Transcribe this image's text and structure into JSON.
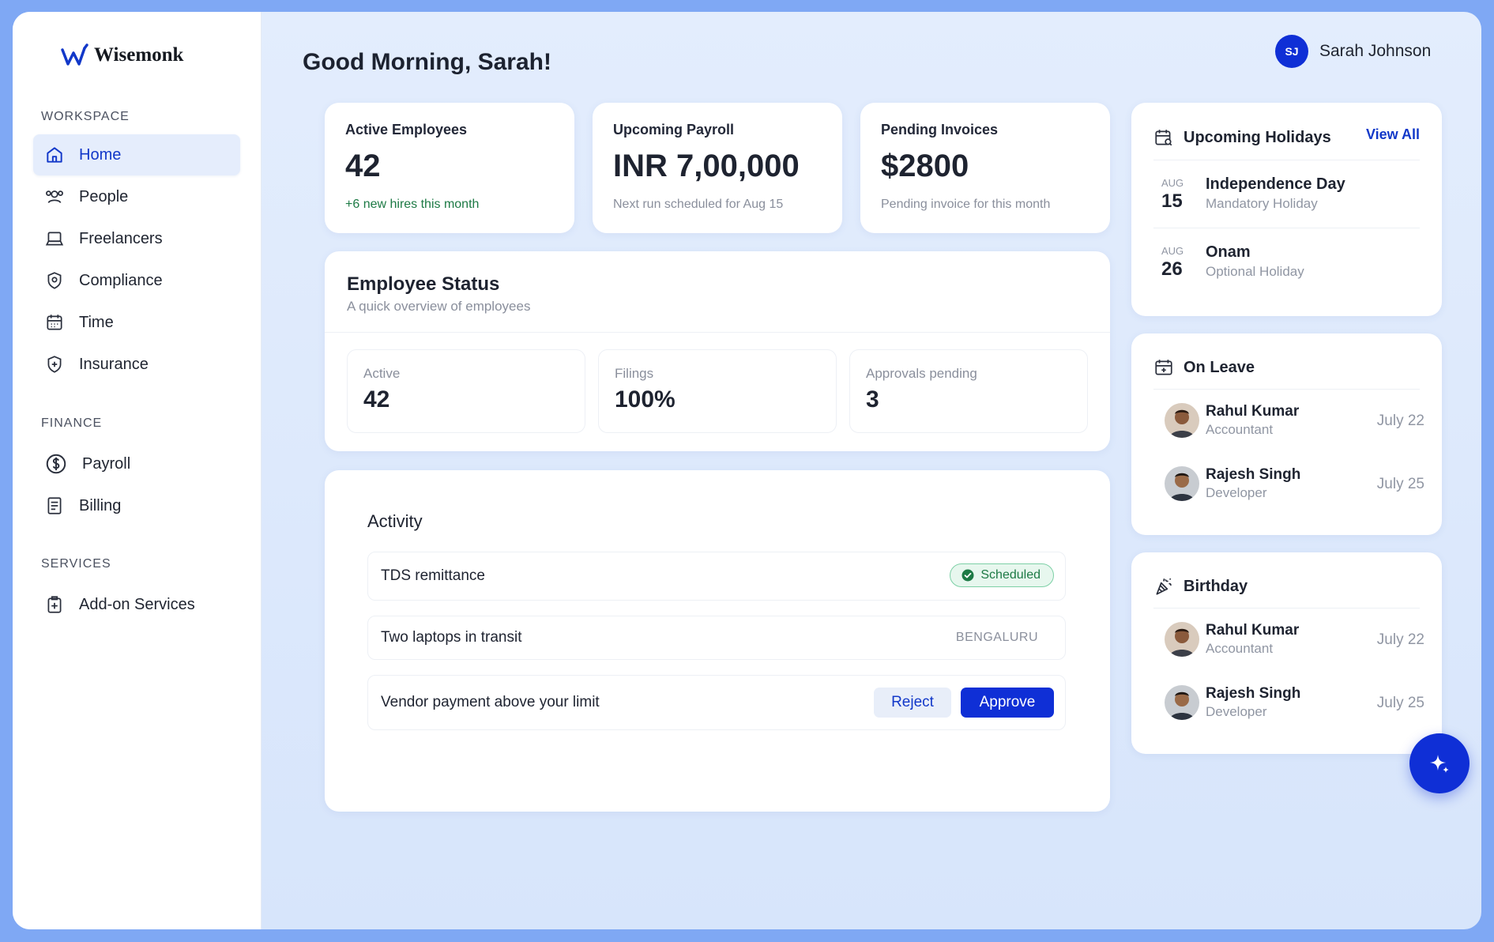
{
  "brand": {
    "name": "Wisemonk"
  },
  "sidebar": {
    "sections": {
      "workspace": "WORKSPACE",
      "finance": "FINANCE",
      "services": "SERVICES"
    },
    "items": [
      {
        "label": "Home",
        "icon": "home-icon"
      },
      {
        "label": "People",
        "icon": "people-icon"
      },
      {
        "label": "Freelancers",
        "icon": "laptop-icon"
      },
      {
        "label": "Compliance",
        "icon": "shield-icon"
      },
      {
        "label": "Time",
        "icon": "calendar-icon"
      },
      {
        "label": "Insurance",
        "icon": "shield-plus-icon"
      },
      {
        "label": "Payroll",
        "icon": "dollar-icon"
      },
      {
        "label": "Billing",
        "icon": "receipt-icon"
      },
      {
        "label": "Add-on Services",
        "icon": "plus-box-icon"
      }
    ]
  },
  "header": {
    "greeting": "Good Morning, Sarah!",
    "user": {
      "initials": "SJ",
      "name": "Sarah Johnson"
    }
  },
  "stats": [
    {
      "title": "Active Employees",
      "value": "42",
      "note": "+6 new hires this month"
    },
    {
      "title": "Upcoming Payroll",
      "value": "INR 7,00,000",
      "note": "Next run scheduled for Aug 15"
    },
    {
      "title": "Pending Invoices",
      "value": "$2800",
      "note": "Pending invoice for this month"
    }
  ],
  "employee_status": {
    "title": "Employee Status",
    "subtitle": "A quick overview of employees",
    "items": [
      {
        "label": "Active",
        "value": "42"
      },
      {
        "label": "Filings",
        "value": "100%"
      },
      {
        "label": "Approvals pending",
        "value": "3"
      }
    ]
  },
  "activity": {
    "title": "Activity",
    "items": [
      {
        "text": "TDS remittance",
        "status": "Scheduled"
      },
      {
        "text": "Two laptops in transit",
        "location": "BENGALURU"
      },
      {
        "text": "Vendor payment above your limit",
        "reject": "Reject",
        "approve": "Approve"
      }
    ]
  },
  "holidays": {
    "title": "Upcoming Holidays",
    "view_all": "View All",
    "items": [
      {
        "month": "AUG",
        "day": "15",
        "name": "Independence Day",
        "type": "Mandatory Holiday"
      },
      {
        "month": "AUG",
        "day": "26",
        "name": "Onam",
        "type": "Optional Holiday"
      }
    ]
  },
  "on_leave": {
    "title": "On Leave",
    "items": [
      {
        "name": "Rahul Kumar",
        "role": "Accountant",
        "date": "July 22"
      },
      {
        "name": "Rajesh Singh",
        "role": "Developer",
        "date": "July 25"
      }
    ]
  },
  "birthday": {
    "title": "Birthday",
    "items": [
      {
        "name": "Rahul Kumar",
        "role": "Accountant",
        "date": "July 22"
      },
      {
        "name": "Rajesh Singh",
        "role": "Developer",
        "date": "July 25"
      }
    ]
  },
  "colors": {
    "accent": "#0f2fd6",
    "success": "#1d7a45",
    "frame": "#7fa8f4"
  }
}
